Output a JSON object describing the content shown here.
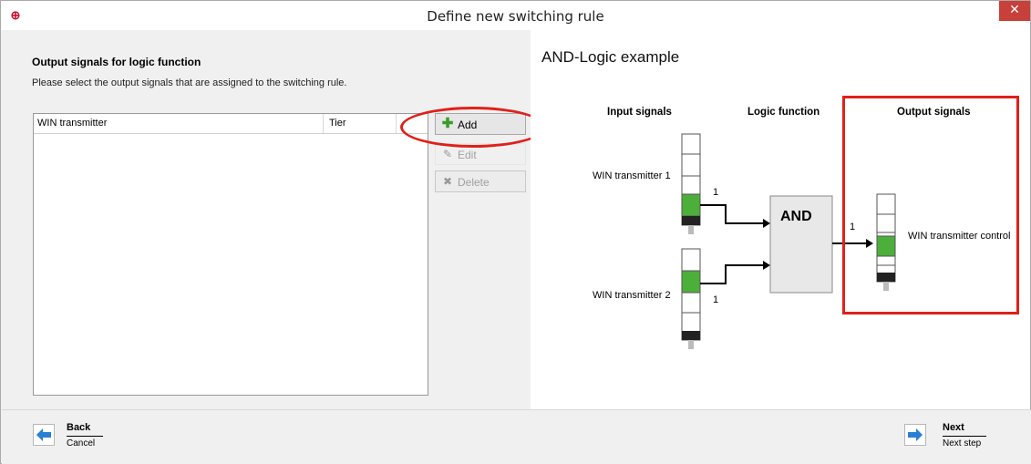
{
  "window": {
    "title": "Define new switching rule",
    "close_label": "✕"
  },
  "left": {
    "heading": "Output signals for logic function",
    "instruction": "Please select the output signals that are assigned to the switching rule.",
    "table": {
      "columns": [
        "WIN transmitter",
        "Tier"
      ],
      "rows": []
    },
    "buttons": {
      "add": "Add",
      "edit": "Edit",
      "delete": "Delete"
    }
  },
  "example": {
    "title": "AND-Logic example",
    "col_input": "Input signals",
    "col_logic": "Logic function",
    "col_output": "Output signals",
    "input1_label": "WIN transmitter 1",
    "input2_label": "WIN transmitter 2",
    "signal1": "1",
    "signal2": "1",
    "logic_label": "AND",
    "out_signal": "1",
    "output_label": "WIN transmitter control",
    "colors": {
      "green": "#4caf3a",
      "dark": "#222222",
      "highlight": "#e0201a"
    }
  },
  "footer": {
    "back_label": "Back",
    "back_sub": "Cancel",
    "next_label": "Next",
    "next_sub": "Next step"
  }
}
